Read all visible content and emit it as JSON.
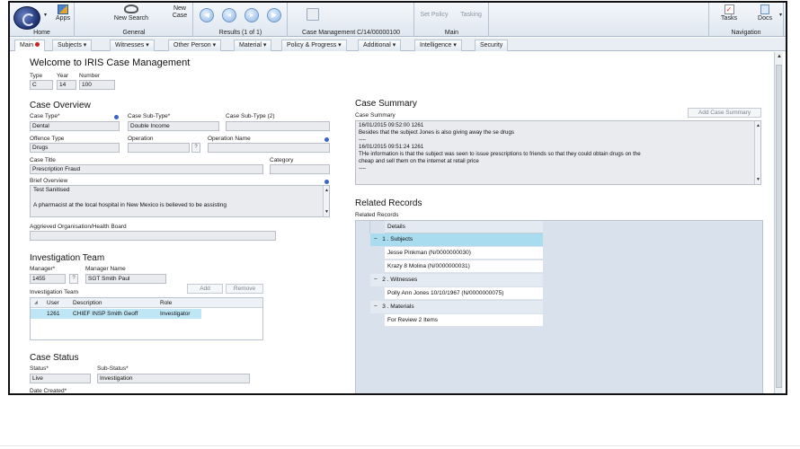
{
  "ribbon": {
    "home": {
      "apps_label": "Apps",
      "group_label": "Home"
    },
    "general": {
      "new_search_label": "New Search",
      "new_case_label": "New Case",
      "group_label": "General"
    },
    "results": {
      "group_label": "Results (1 of 1)"
    },
    "case_mgmt": {
      "group_label": "Case Management C/14/00000100"
    },
    "main": {
      "set_policy_label": "Set Policy",
      "tasking_label": "Tasking",
      "group_label": "Main"
    },
    "navigation": {
      "tasks_label": "Tasks",
      "docs_label": "Docs",
      "group_label": "Navigation"
    }
  },
  "tabs": [
    {
      "label": "Main"
    },
    {
      "label": "Subjects ▾"
    },
    {
      "label": "Witnesses ▾"
    },
    {
      "label": "Other Person ▾"
    },
    {
      "label": "Material ▾"
    },
    {
      "label": "Policy & Progress ▾"
    },
    {
      "label": "Additional ▾"
    },
    {
      "label": "Intelligence ▾"
    },
    {
      "label": "Security"
    }
  ],
  "welcome": {
    "title": "Welcome to IRIS Case Management",
    "type_label": "Type",
    "type_value": "C",
    "year_label": "Year",
    "year_value": "14",
    "number_label": "Number",
    "number_value": "100"
  },
  "overview": {
    "title": "Case Overview",
    "case_type_label": "Case Type*",
    "case_type_value": "Dental",
    "case_subtype_label": "Case Sub-Type*",
    "case_subtype_value": "Double Income",
    "case_subtype2_label": "Case Sub-Type (2)",
    "case_subtype2_value": "",
    "offence_type_label": "Offence Type",
    "offence_type_value": "Drugs",
    "operation_label": "Operation",
    "operation_value": "",
    "operation_name_label": "Operation Name",
    "operation_name_value": "",
    "case_title_label": "Case Title",
    "case_title_value": "Prescription Fraud",
    "category_label": "Category",
    "category_value": "",
    "brief_label": "Brief Overview",
    "brief_line1": "Test Sanitised",
    "brief_line2": "A pharmacist at the local hospital in New Mexico is believed to be assisting",
    "aggrieved_label": "Aggrieved Organisation/Health Board",
    "aggrieved_value": ""
  },
  "team": {
    "title": "Investigation Team",
    "manager_label": "Manager*",
    "manager_value": "1455",
    "manager_name_label": "Manager Name",
    "manager_name_value": "SGT Smith Paul",
    "grid_label": "Investigation Team",
    "add_label": "Add",
    "remove_label": "Remove",
    "columns": [
      "User",
      "Description",
      "Role"
    ],
    "rows": [
      {
        "user": "1261",
        "description": "CHIEF INSP Smith Geoff",
        "role": "Investigator"
      }
    ]
  },
  "status": {
    "title": "Case Status",
    "status_label": "Status*",
    "status_value": "Live",
    "substatus_label": "Sub-Status*",
    "substatus_value": "Investigation",
    "date_created_label": "Date Created*"
  },
  "summary": {
    "title": "Case Summary",
    "field_label": "Case Summary",
    "add_label": "Add Case Summary",
    "line1": "16/01/2015 09:52:00 1261",
    "line2": "Besides that the subject Jones is also giving away the se drugs",
    "line3": "----",
    "line4": "16/01/2015 09:51:24 1261",
    "line5": "THe information is that the subject was seen to issue prescriptions to friends so that they could obtain drugs on the",
    "line6": "cheap and sell them on the internet at retail price",
    "line7": "----"
  },
  "related": {
    "title": "Related Records",
    "field_label": "Related Records",
    "column": "Details",
    "group1": "1 . Subjects",
    "g1_row1": "Jesse Pinkman (N/0000000030)",
    "g1_row2": "Krazy 8 Molina (N/0000000031)",
    "group2": "2 . Witnesses",
    "g2_row1": "Polly Ann Jones 10/10/1967 (N/0000000075)",
    "group3": "3 . Materials",
    "g3_row1": "For Review 2 Items"
  },
  "colors": {
    "accent": "#a9dcef",
    "selected_row": "#bfe6f5",
    "panel_bg": "#d9e2ec",
    "active_tab_dot": "#d42020"
  },
  "icons": [
    "app-logo-icon",
    "apps-icon",
    "new-search-icon",
    "new-case-icon",
    "first-icon",
    "previous-icon",
    "next-icon",
    "last-icon",
    "save-icon",
    "tasks-icon",
    "docs-icon",
    "info-icon",
    "expand-icon"
  ]
}
